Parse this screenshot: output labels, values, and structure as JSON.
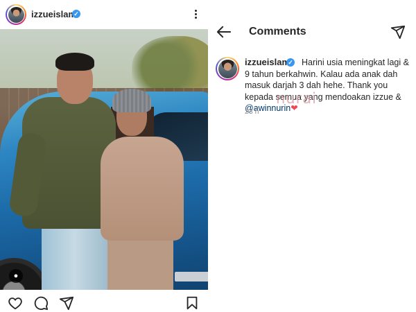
{
  "post": {
    "username": "izzueislam",
    "verified_glyph": "✓",
    "menu_icon": "more-vertical-icon",
    "tag_icon_glyph": "●",
    "actions": [
      "like-icon",
      "comment-icon",
      "share-icon",
      "save-icon"
    ]
  },
  "comments": {
    "title": "Comments",
    "back_icon": "back-arrow-icon",
    "send_icon": "direct-message-icon",
    "items": [
      {
        "username": "izzueislam",
        "verified": true,
        "text_before_mention": "Harini usia meningkat lagi & 9 tahun berkahwin. Kalau ada anak dah masuk darjah 3 dah hehe. Thank you kepada semua yang mendoakan izzue &",
        "mention": "@awinnurin",
        "emoji": "❤",
        "time": "23 h"
      }
    ]
  },
  "watermark": "nurai",
  "colors": {
    "verified": "#3897f0",
    "mention": "#00376b",
    "heart": "#ed4956",
    "meta_text": "#8e8e8e"
  }
}
